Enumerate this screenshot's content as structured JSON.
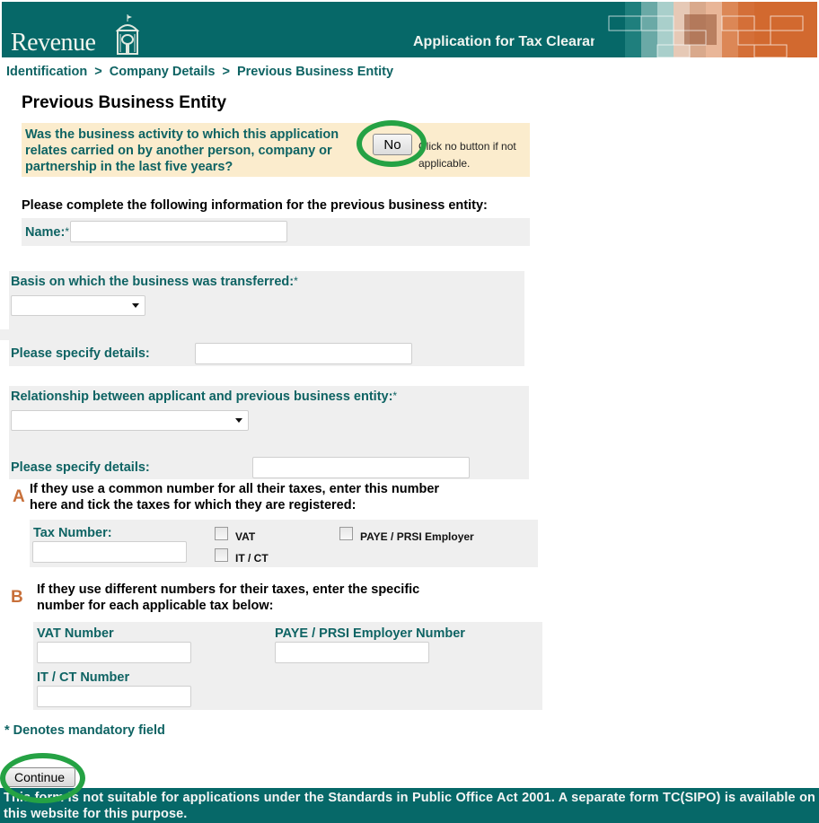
{
  "header": {
    "logo_text": "Revenue",
    "app_title": "Application for Tax Clearance",
    "brand_color": "#066868",
    "accent_color": "#d2692f"
  },
  "breadcrumb": {
    "items": [
      "Identification",
      "Company Details",
      "Previous Business Entity"
    ],
    "separator": ">"
  },
  "page_title": "Previous Business Entity",
  "question": {
    "text": "Was the business activity to which this application relates carried on by another person, company or partnership in the last five years?",
    "no_button_label": "No",
    "hint": "Click no button if not applicable."
  },
  "section_intro": "Please complete the following information for the previous business entity:",
  "name_field": {
    "label": "Name:",
    "required_marker": "*",
    "value": ""
  },
  "transfer_basis": {
    "label": "Basis on which the business was transferred:",
    "required_marker": "*",
    "selected": "",
    "details_label": "Please specify details:",
    "details_value": ""
  },
  "relationship": {
    "label": "Relationship between applicant and previous business entity:",
    "required_marker": "*",
    "selected": "",
    "details_label": "Please specify details:",
    "details_value": ""
  },
  "section_a": {
    "letter": "A",
    "text": "If they use a common number for all their taxes, enter this number here and tick the taxes for which they are registered:",
    "tax_number_label": "Tax Number:",
    "tax_number_value": "",
    "checkboxes": [
      {
        "label": "VAT",
        "checked": false
      },
      {
        "label": "IT / CT",
        "checked": false
      },
      {
        "label": "PAYE / PRSI Employer",
        "checked": false
      }
    ]
  },
  "section_b": {
    "letter": "B",
    "text": "If they use different numbers for their taxes, enter the specific number for each applicable tax below:",
    "vat_label": "VAT Number",
    "paye_label": "PAYE / PRSI Employer Number",
    "itct_label": "IT / CT Number"
  },
  "mandatory_note": "* Denotes mandatory field",
  "continue_button_label": "Continue",
  "footer_text": "This form is not suitable for applications under the Standards in Public Office Act 2001. A separate form TC(SIPO) is available on this website for this purpose."
}
